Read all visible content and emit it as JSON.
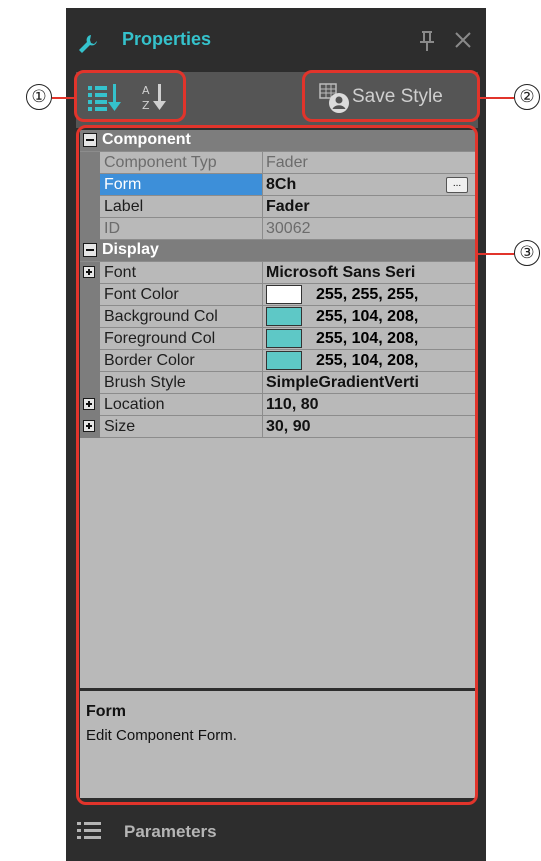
{
  "window": {
    "title": "Properties",
    "icon": "wrench-icon",
    "pin_icon": "pin-icon",
    "close_icon": "close-icon"
  },
  "toolbar": {
    "categorized_icon": "categorized-list-icon",
    "alphabetical_icon": "alphabetical-sort-icon",
    "save_style_label": "Save Style"
  },
  "grid": {
    "categories": [
      {
        "label": "Component",
        "properties": [
          {
            "name": "Component Typ",
            "value": "Fader",
            "disabled": true
          },
          {
            "name": "Form",
            "value": "8Ch",
            "bold": true,
            "selected": true,
            "has_button": true,
            "button_label": "..."
          },
          {
            "name": "Label",
            "value": "Fader",
            "bold": true
          },
          {
            "name": "ID",
            "value": "30062",
            "disabled": true
          }
        ]
      },
      {
        "label": "Display",
        "properties": [
          {
            "name": "Font",
            "value": "Microsoft Sans Seri",
            "bold": true,
            "expandable": true
          },
          {
            "name": "Font Color",
            "value": "255, 255, 255,",
            "swatch": "#ffffff"
          },
          {
            "name": "Background Col",
            "value": "255, 104, 208,",
            "swatch": "#5ec8c6"
          },
          {
            "name": "Foreground Col",
            "value": "255, 104, 208,",
            "swatch": "#5ec8c6"
          },
          {
            "name": "Border Color",
            "value": "255, 104, 208,",
            "swatch": "#5ec8c6"
          },
          {
            "name": "Brush Style",
            "value": "SimpleGradientVerti",
            "bold": true
          },
          {
            "name": "Location",
            "value": "110, 80",
            "bold": true,
            "expandable": true
          },
          {
            "name": "Size",
            "value": "30, 90",
            "bold": true,
            "expandable": true
          }
        ]
      }
    ]
  },
  "description": {
    "title": "Form",
    "text": "Edit Component Form."
  },
  "bottom_tab": {
    "label": "Parameters",
    "icon": "list-icon"
  },
  "callouts": [
    "①",
    "②",
    "③"
  ],
  "colors": {
    "accent": "#35c2cc",
    "highlight": "#e1342b",
    "selection": "#3d8fd9"
  }
}
